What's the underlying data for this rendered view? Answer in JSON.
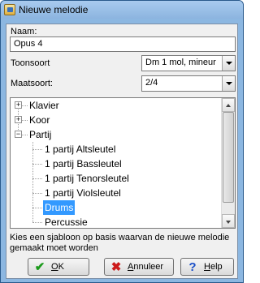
{
  "window": {
    "title": "Nieuwe melodie"
  },
  "form": {
    "name_label": "Naam:",
    "name_value": "Opus 4",
    "key_label": "Toonsoort",
    "key_value": "Dm   1 mol, mineur",
    "meter_label": "Maatsoort:",
    "meter_value": "2/4"
  },
  "tree": {
    "items": [
      {
        "label": "Klavier",
        "expander": "+"
      },
      {
        "label": "Koor",
        "expander": "+"
      },
      {
        "label": "Partij",
        "expander": "−"
      },
      {
        "label": "1 partij Altsleutel"
      },
      {
        "label": "1 partij Bassleutel"
      },
      {
        "label": "1 partij Tenorsleutel"
      },
      {
        "label": "1 partij Violsleutel"
      },
      {
        "label": "Drums",
        "selected": true
      },
      {
        "label": "Percussie"
      }
    ]
  },
  "hint": "Kies een sjabloon op basis waarvan de nieuwe melodie gemaakt moet worden",
  "buttons": {
    "ok": {
      "accel": "O",
      "rest": "K"
    },
    "cancel": {
      "accel": "A",
      "rest": "nnuleer"
    },
    "help": {
      "accel": "H",
      "rest": "elp"
    }
  },
  "colors": {
    "selection": "#3399ff",
    "titlebar": "#8cb7e1"
  }
}
